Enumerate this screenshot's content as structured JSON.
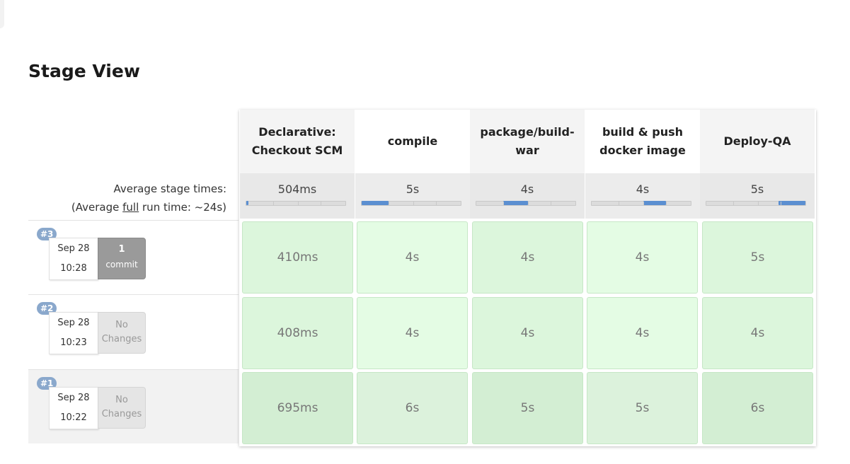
{
  "title": "Stage View",
  "average": {
    "label_line1": "Average stage times:",
    "label_prefix": "(Average ",
    "label_underlined": "full",
    "label_suffix": " run time: ~24s)"
  },
  "stages": [
    {
      "name": "Declarative: Checkout SCM",
      "avg": "504ms",
      "avg_fraction_start": 0.0,
      "avg_fraction": 0.02
    },
    {
      "name": "compile",
      "avg": "5s",
      "avg_fraction_start": 0.0,
      "avg_fraction": 0.27
    },
    {
      "name": "package/build-war",
      "avg": "4s",
      "avg_fraction_start": 0.27,
      "avg_fraction": 0.25
    },
    {
      "name": "build & push docker image",
      "avg": "4s",
      "avg_fraction_start": 0.52,
      "avg_fraction": 0.23
    },
    {
      "name": "Deploy-QA",
      "avg": "5s",
      "avg_fraction_start": 0.73,
      "avg_fraction": 0.27
    }
  ],
  "runs": [
    {
      "id": "#3",
      "date": "Sep 28",
      "time": "10:28",
      "changes_count": "1",
      "changes_label": "commit",
      "has_changes": true,
      "durations": [
        "410ms",
        "4s",
        "4s",
        "4s",
        "5s"
      ]
    },
    {
      "id": "#2",
      "date": "Sep 28",
      "time": "10:23",
      "changes_count": "No",
      "changes_label": "Changes",
      "has_changes": false,
      "durations": [
        "408ms",
        "4s",
        "4s",
        "4s",
        "4s"
      ]
    },
    {
      "id": "#1",
      "date": "Sep 28",
      "time": "10:22",
      "changes_count": "No",
      "changes_label": "Changes",
      "has_changes": false,
      "durations": [
        "695ms",
        "6s",
        "5s",
        "5s",
        "6s"
      ]
    }
  ],
  "colors": {
    "success_cell": "#dcf6dc",
    "success_border": "#c6e7c6",
    "avg_bar_fill": "#5b8fd1",
    "build_badge": "#8aa8cc"
  }
}
